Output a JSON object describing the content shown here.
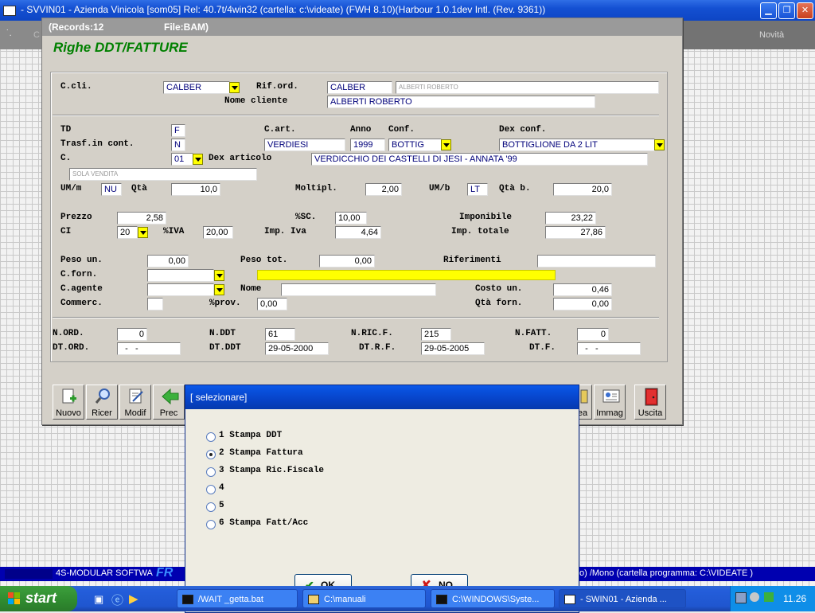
{
  "app": {
    "title": "- SVVIN01 - Azienda Vinicola          [som05]    Rel: 40.7t/4win32           (cartella: c:\\videate) (FWH 8.10)(Harbour 1.0.1dev Intl. (Rev. 9361))",
    "novita_label": "Novità",
    "ghost_label": "C"
  },
  "window": {
    "records_label": "(Records:12",
    "file_label": "File:BAM)",
    "form_title": "Righe DDT/FATTURE"
  },
  "form": {
    "ccli_label": "C.cli.",
    "ccli_value": "CALBER",
    "riford_label": "Rif.ord.",
    "riford_value": "CALBER",
    "riford_desc": "ALBERTI ROBERTO",
    "nome_cliente_label": "Nome cliente",
    "nome_cliente_value": "ALBERTI ROBERTO",
    "td_label": "TD",
    "td_value": "F",
    "trasf_label": "Trasf.in cont.",
    "trasf_value": "N",
    "c_label": "C.",
    "c_value": "01",
    "cart_label": "C.art.",
    "cart_value": "VERDIESI",
    "anno_label": "Anno",
    "anno_value": "1999",
    "conf_label": "Conf.",
    "conf_value": "BOTTIG",
    "dexconf_label": "Dex conf.",
    "dexconf_value": "BOTTIGLIONE DA 2 LIT",
    "dexart_label": "Dex articolo",
    "dexart_value": "VERDICCHIO DEI CASTELLI DI JESI - ANNATA '99",
    "sola_vendita": "SOLA VENDITA",
    "umm_label": "UM/m",
    "umm_value": "NU",
    "qta_label": "Qtà",
    "qta_value": "10,0",
    "moltipl_label": "Moltipl.",
    "moltipl_value": "2,00",
    "umb_label": "UM/b",
    "umb_value": "LT",
    "qtab_label": "Qtà b.",
    "qtab_value": "20,0",
    "prezzo_label": "Prezzo",
    "prezzo_value": "2,58",
    "sc_label": "%SC.",
    "sc_value": "10,00",
    "imponibile_label": "Imponibile",
    "imponibile_value": "23,22",
    "ci_label": "CI",
    "ci_value": "20",
    "iva_label": "%IVA",
    "iva_value": "20,00",
    "impiva_label": "Imp. Iva",
    "impiva_value": "4,64",
    "imptot_label": "Imp. totale",
    "imptot_value": "27,86",
    "pesoun_label": "Peso un.",
    "pesoun_value": "0,00",
    "pesotot_label": "Peso tot.",
    "pesotot_value": "0,00",
    "rif1_label": "Riferimenti",
    "rif1_value": "",
    "cforn_label": "C.forn.",
    "cforn_value": "",
    "cagente_label": "C.agente",
    "cagente_value": "",
    "nome_label": "Nome",
    "nome_value": "",
    "costoun_label": "Costo un.",
    "costoun_value": "0,46",
    "commerc_label": "Commerc.",
    "commerc_value": "",
    "prov_label": "%prov.",
    "prov_value": "0,00",
    "qtaforn_label": "Qtà forn.",
    "qtaforn_value": "0,00",
    "nord_label": "N.ORD.",
    "nord_value": "0",
    "nddt_label": "N.DDT",
    "nddt_value": "61",
    "nricf_label": "N.RIC.F.",
    "nricf_value": "215",
    "nfatt_label": "N.FATT.",
    "nfatt_value": "0",
    "dtord_label": "DT.ORD.",
    "dtord_value": "  -   -",
    "dtddt_label": "DT.DDT",
    "dtddt_value": "29-05-2000",
    "dtrf_label": "DT.R.F.",
    "dtrf_value": "29-05-2005",
    "dtf_label": "DT.F.",
    "dtf_value": "  -   -"
  },
  "toolbar": {
    "nuovo": "Nuovo",
    "ricer": "Ricer",
    "modif": "Modif",
    "prec": "Prec",
    "ea": "ea",
    "immag": "Immag",
    "uscita": "Uscita"
  },
  "modal": {
    "title": "[ selezionare]",
    "options": [
      {
        "label": "1 Stampa DDT",
        "selected": false
      },
      {
        "label": "2 Stampa Fattura",
        "selected": true
      },
      {
        "label": "3 Stampa Ric.Fiscale",
        "selected": false
      },
      {
        "label": "4",
        "selected": false
      },
      {
        "label": "5",
        "selected": false
      },
      {
        "label": "6 Stampa Fatt/Acc",
        "selected": false
      }
    ],
    "ok_label": "OK",
    "no_label": "NO"
  },
  "statusbar": {
    "left": "4S-MODULAR SOFTWA",
    "brand": "FR",
    "right": "o)  /Mono  (cartella programma: C:\\VIDEATE )"
  },
  "taskbar": {
    "start_label": "start",
    "tasks": [
      "/WAIT _getta.bat",
      "C:\\manuali",
      "C:\\WINDOWS\\Syste...",
      "- SWIN01 - Azienda ..."
    ],
    "clock": "11.26"
  },
  "colors": {
    "accent_green": "#008000",
    "field_yellow": "#ffff00",
    "xp_blue": "#0a58e8"
  }
}
